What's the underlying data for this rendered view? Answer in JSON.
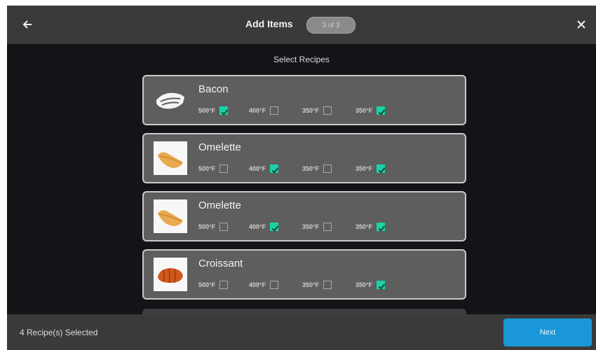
{
  "header": {
    "title": "Add Items",
    "step": "3 of 3",
    "back_icon": "arrow-left-icon",
    "close_icon": "close-icon"
  },
  "subtitle": "Select Recipes",
  "recipes": [
    {
      "name": "Bacon",
      "icon": "bacon-icon",
      "temps": [
        {
          "label": "500°F",
          "checked": true
        },
        {
          "label": "400°F",
          "checked": false
        },
        {
          "label": "350°F",
          "checked": false
        },
        {
          "label": "350°F",
          "checked": true
        }
      ]
    },
    {
      "name": "Omelette",
      "icon": "omelette-image",
      "temps": [
        {
          "label": "500°F",
          "checked": false
        },
        {
          "label": "400°F",
          "checked": true
        },
        {
          "label": "350°F",
          "checked": false
        },
        {
          "label": "350°F",
          "checked": true
        }
      ]
    },
    {
      "name": "Omelette",
      "icon": "omelette-image",
      "temps": [
        {
          "label": "500°F",
          "checked": false
        },
        {
          "label": "400°F",
          "checked": true
        },
        {
          "label": "350°F",
          "checked": false
        },
        {
          "label": "350°F",
          "checked": true
        }
      ]
    },
    {
      "name": "Croissant",
      "icon": "croissant-image",
      "temps": [
        {
          "label": "500°F",
          "checked": false
        },
        {
          "label": "400°F",
          "checked": false
        },
        {
          "label": "350°F",
          "checked": false
        },
        {
          "label": "350°F",
          "checked": true
        }
      ]
    }
  ],
  "footer": {
    "status": "4 Recipe(s) Selected",
    "next_label": "Next"
  },
  "colors": {
    "accent_check": "#19d3a8",
    "next_button": "#1a97d8",
    "bar_bg": "#3a3a3a",
    "card_bg": "#5e5e5e"
  }
}
